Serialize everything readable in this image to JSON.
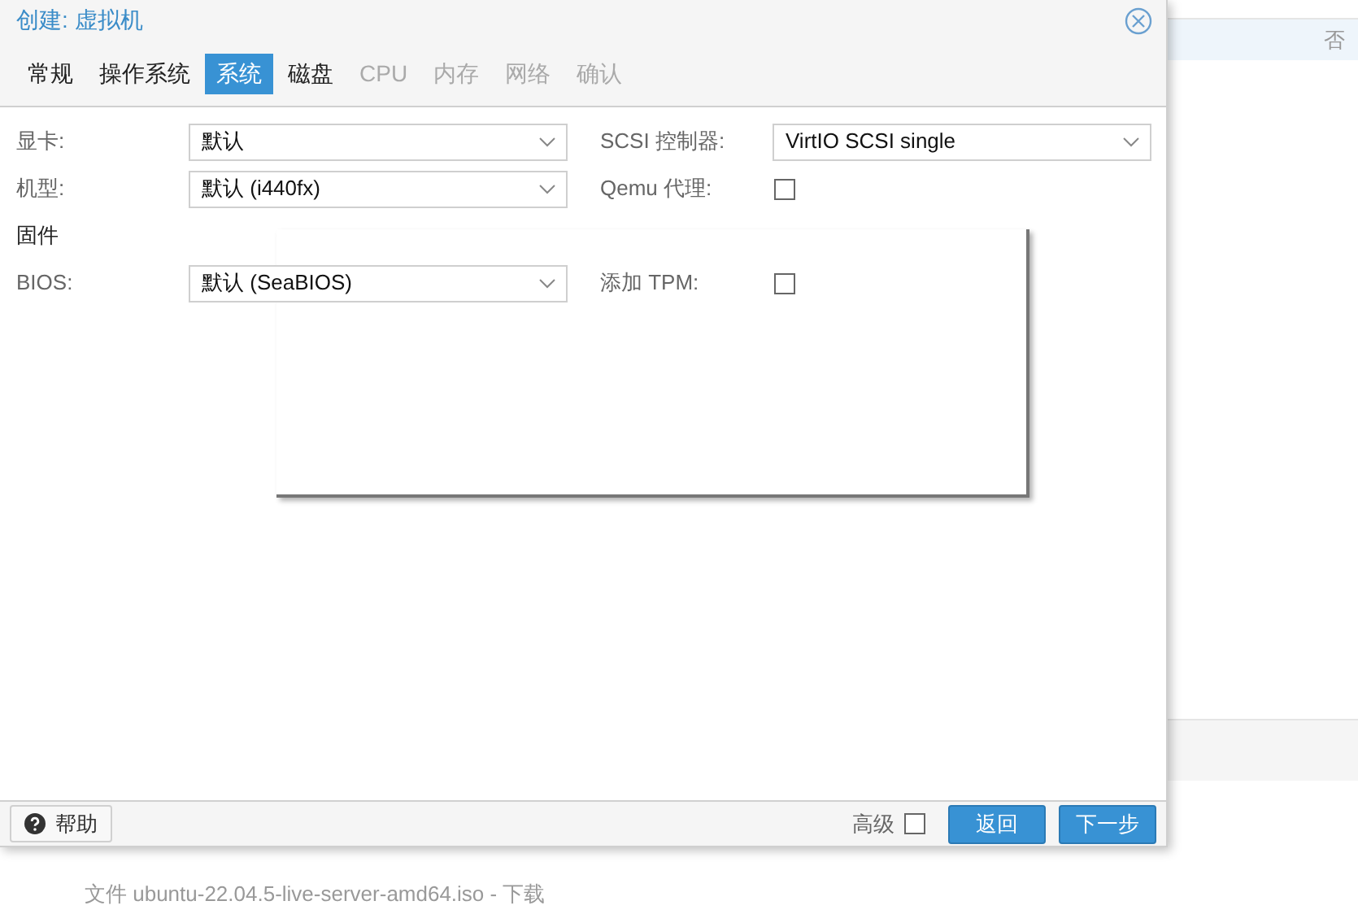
{
  "background": {
    "row_value": "否",
    "status_text": "文件 ubuntu-22.04.5-live-server-amd64.iso - 下载"
  },
  "dialog": {
    "title": "创建: 虚拟机",
    "tabs": [
      {
        "label": "常规",
        "selected": false,
        "disabled": false
      },
      {
        "label": "操作系统",
        "selected": false,
        "disabled": false
      },
      {
        "label": "系统",
        "selected": true,
        "disabled": false
      },
      {
        "label": "磁盘",
        "selected": false,
        "disabled": false
      },
      {
        "label": "CPU",
        "selected": false,
        "disabled": true
      },
      {
        "label": "内存",
        "selected": false,
        "disabled": true
      },
      {
        "label": "网络",
        "selected": false,
        "disabled": true
      },
      {
        "label": "确认",
        "selected": false,
        "disabled": true
      }
    ],
    "form": [
      {
        "kind": "row",
        "cells": [
          {
            "kind": "select",
            "label": "显卡:",
            "value": "默认"
          },
          {
            "kind": "select",
            "label": "SCSI 控制器:",
            "value": "VirtIO SCSI single"
          }
        ]
      },
      {
        "kind": "row",
        "cells": [
          {
            "kind": "select",
            "label": "机型:",
            "value": "默认 (i440fx)"
          },
          {
            "kind": "checkbox",
            "label": "Qemu 代理:",
            "checked": false
          }
        ]
      },
      {
        "kind": "heading",
        "text": "固件"
      },
      {
        "kind": "row",
        "cells": [
          {
            "kind": "select",
            "label": "BIOS:",
            "value": "默认 (SeaBIOS)"
          },
          {
            "kind": "checkbox",
            "label": "添加 TPM:",
            "checked": false
          }
        ]
      }
    ],
    "footer": {
      "help": "帮助",
      "advanced": {
        "label": "高级",
        "checked": false
      },
      "buttons": [
        "返回",
        "下一步"
      ]
    }
  }
}
